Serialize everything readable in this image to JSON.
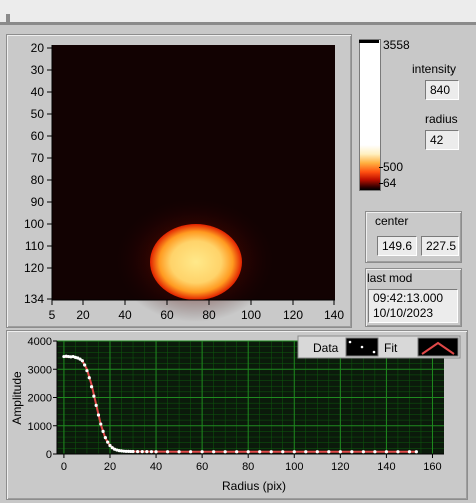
{
  "image_panel": {
    "y_ticks": [
      "20",
      "30",
      "40",
      "50",
      "60",
      "70",
      "80",
      "90",
      "100",
      "110",
      "120",
      "134"
    ],
    "x_ticks": [
      "5",
      "20",
      "40",
      "60",
      "80",
      "100",
      "120",
      "140"
    ]
  },
  "colorbar": {
    "labels": [
      "3558",
      "500",
      "64"
    ]
  },
  "intensity": {
    "label": "intensity",
    "value": "840"
  },
  "radius": {
    "label": "radius",
    "value": "42"
  },
  "center": {
    "label": "center",
    "x": "149.6",
    "y": "227.5"
  },
  "last_mod": {
    "label": "last mod",
    "time": "09:42:13.000",
    "date": "10/10/2023"
  },
  "plot": {
    "legend": {
      "data_label": "Data",
      "fit_label": "Fit"
    }
  },
  "chart_data": {
    "type": "line",
    "title": "",
    "xlabel": "Radius (pix)",
    "ylabel": "Amplitude",
    "xlim": [
      -3,
      165
    ],
    "ylim": [
      0,
      4000
    ],
    "x_ticks": [
      "0",
      "20",
      "40",
      "60",
      "80",
      "100",
      "120",
      "140",
      "160"
    ],
    "y_ticks": [
      "0",
      "1000",
      "2000",
      "3000",
      "4000"
    ],
    "grid": true,
    "legend": "top-right",
    "series": [
      {
        "name": "Data",
        "style": "points",
        "color": "#ffffff",
        "x": [
          0,
          1,
          2,
          3,
          4,
          5,
          6,
          7,
          8,
          9,
          10,
          11,
          12,
          13,
          14,
          15,
          16,
          17,
          18,
          19,
          20,
          21,
          22,
          23,
          24,
          25,
          26,
          27,
          28,
          29,
          30,
          32,
          34,
          36,
          38,
          40,
          45,
          50,
          55,
          60,
          65,
          70,
          75,
          80,
          85,
          90,
          95,
          100,
          105,
          110,
          115,
          120,
          125,
          130,
          135,
          140,
          145,
          150,
          153
        ],
        "y": [
          3450,
          3460,
          3450,
          3440,
          3450,
          3420,
          3400,
          3360,
          3300,
          3150,
          2950,
          2700,
          2380,
          2050,
          1720,
          1380,
          1060,
          800,
          580,
          420,
          300,
          220,
          170,
          140,
          120,
          110,
          100,
          95,
          92,
          90,
          88,
          86,
          84,
          83,
          82,
          80,
          80,
          80,
          80,
          80,
          80,
          80,
          80,
          80,
          80,
          80,
          80,
          80,
          80,
          80,
          80,
          80,
          80,
          80,
          80,
          80,
          80,
          80,
          80
        ]
      },
      {
        "name": "Fit",
        "style": "line",
        "color": "#e04848",
        "x": [
          0,
          2,
          4,
          6,
          8,
          10,
          12,
          14,
          16,
          18,
          20,
          22,
          24,
          26,
          28,
          30,
          35,
          40,
          50,
          60,
          80,
          100,
          120,
          140,
          153
        ],
        "y": [
          3440,
          3440,
          3435,
          3400,
          3300,
          3000,
          2450,
          1750,
          1050,
          560,
          300,
          170,
          120,
          100,
          92,
          88,
          84,
          82,
          80,
          80,
          80,
          80,
          80,
          80,
          80
        ]
      }
    ]
  },
  "colors": {
    "heatmap_bg": "#120202",
    "spot_core": "#ffd870",
    "plot_bg": "#0b1a0b",
    "grid": "#1f8a1f",
    "fit_line": "#e04848"
  }
}
